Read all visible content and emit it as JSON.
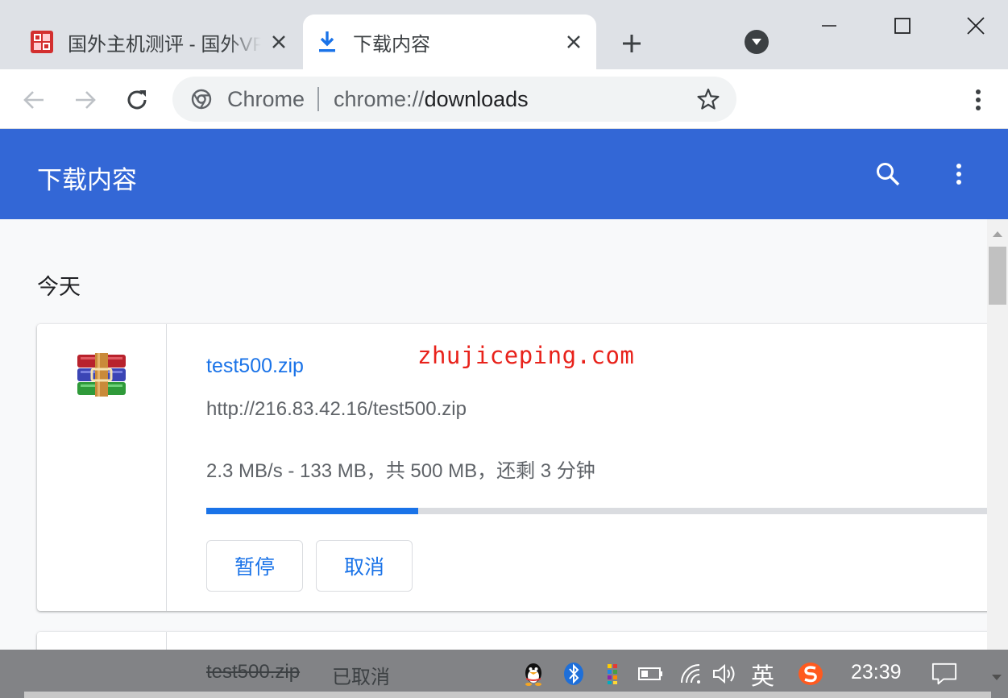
{
  "tabs": [
    {
      "title": "国外主机测评 - 国外VPS，国",
      "icon": "site-logo-icon",
      "active": false
    },
    {
      "title": "下载内容",
      "icon": "download-icon",
      "active": true
    }
  ],
  "omnibox": {
    "chip": "Chrome",
    "url_scheme": "chrome://",
    "url_host": "downloads"
  },
  "header": {
    "title": "下载内容"
  },
  "section": {
    "day": "今天"
  },
  "downloads": [
    {
      "name": "test500.zip",
      "url": "http://216.83.42.16/test500.zip",
      "status": "2.3 MB/s - 133 MB，共 500 MB，还剩 3 分钟",
      "progress_fraction": 0.266,
      "buttons": {
        "pause": "暂停",
        "cancel": "取消"
      }
    },
    {
      "name": "test500.zip",
      "status": "已取消"
    }
  ],
  "watermark": "zhujiceping.com",
  "taskbar": {
    "ime": "英",
    "clock": "23:39"
  },
  "colors": {
    "header_blue": "#3367d6",
    "link_blue": "#1a73e8",
    "watermark_red": "#e8221b"
  }
}
